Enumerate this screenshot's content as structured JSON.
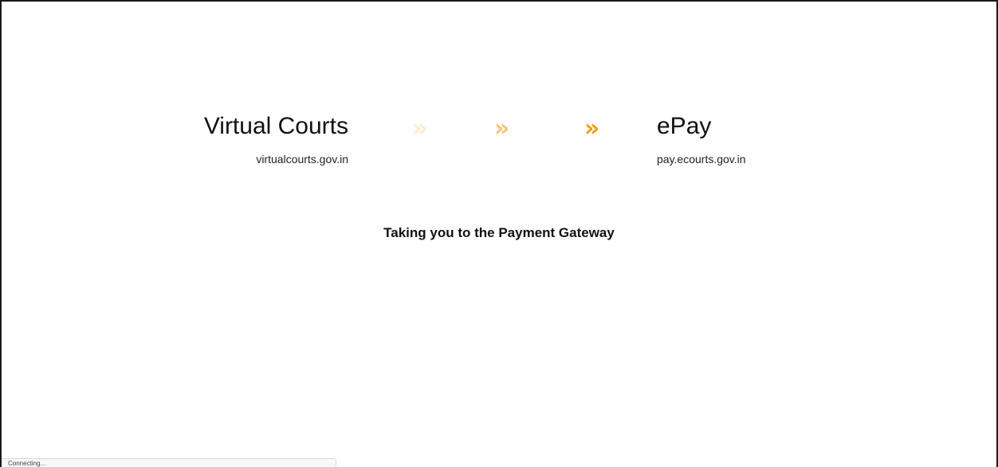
{
  "source": {
    "title": "Virtual Courts",
    "domain": "virtualcourts.gov.in"
  },
  "destination": {
    "title": "ePay",
    "domain": "pay.ecourts.gov.in"
  },
  "progress_arrows": [
    {
      "icon": "chevron-double-right-icon",
      "glyph": "»",
      "opacity": 0.2
    },
    {
      "icon": "chevron-double-right-icon",
      "glyph": "»",
      "opacity": 0.6
    },
    {
      "icon": "chevron-double-right-icon",
      "glyph": "»",
      "opacity": 1.0
    }
  ],
  "message": "Taking you to the Payment Gateway",
  "status_bar": {
    "text": "Connecting..."
  },
  "colors": {
    "accent": "#f39c12",
    "text": "#111111",
    "background": "#ffffff"
  }
}
